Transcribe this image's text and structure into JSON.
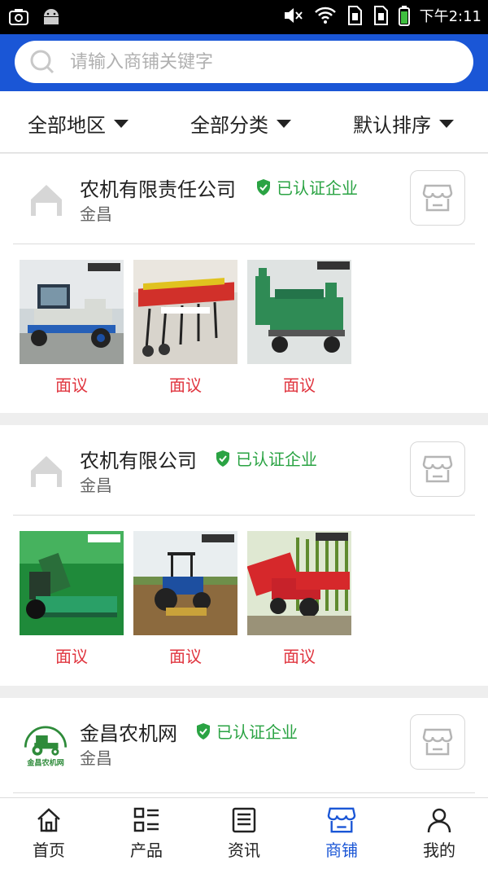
{
  "status_bar": {
    "time": "下午2:11",
    "icons": [
      "camera-icon",
      "android-icon",
      "mute-icon",
      "wifi-icon",
      "sim1-icon",
      "sim2-icon",
      "battery-icon"
    ]
  },
  "search": {
    "placeholder": "请输入商铺关键字",
    "value": ""
  },
  "filters": {
    "region": "全部地区",
    "category": "全部分类",
    "sort": "默认排序"
  },
  "shops": [
    {
      "name": "农机有限责任公司",
      "badge": "已认证企业",
      "location": "金昌",
      "logo": "placeholder-building-icon",
      "products": [
        {
          "image": "tractor-cab-machine",
          "price": "面议"
        },
        {
          "image": "red-seeder-machine",
          "price": "面议"
        },
        {
          "image": "green-grain-cleaner",
          "price": "面议"
        }
      ]
    },
    {
      "name": "农机有限公司",
      "badge": "已认证企业",
      "location": "金昌",
      "logo": "placeholder-building-icon",
      "products": [
        {
          "image": "green-harvester",
          "price": "面议"
        },
        {
          "image": "tractor-peanut-harvester",
          "price": "面议"
        },
        {
          "image": "red-corn-harvester",
          "price": "面议"
        }
      ]
    },
    {
      "name": "金昌农机网",
      "badge": "已认证企业",
      "location": "金昌",
      "logo_text": "金昌农机网"
    }
  ],
  "tabs": [
    {
      "label": "首页",
      "icon": "home-icon",
      "active": false
    },
    {
      "label": "产品",
      "icon": "grid-list-icon",
      "active": false
    },
    {
      "label": "资讯",
      "icon": "news-icon",
      "active": false
    },
    {
      "label": "商铺",
      "icon": "store-icon",
      "active": true
    },
    {
      "label": "我的",
      "icon": "user-icon",
      "active": false
    }
  ],
  "colors": {
    "brand_blue": "#1a56d6",
    "verified_green": "#2aa343",
    "price_red": "#e0353f"
  }
}
